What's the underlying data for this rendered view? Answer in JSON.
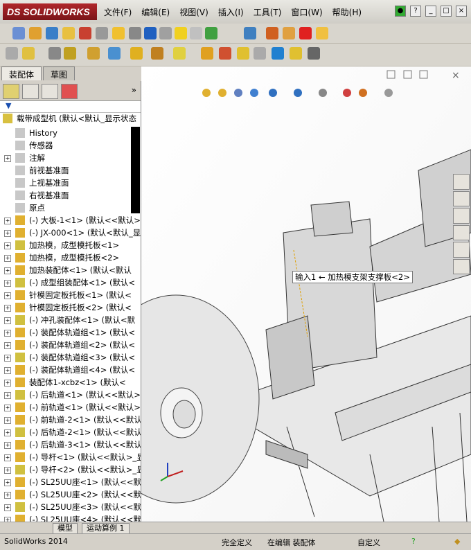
{
  "app": {
    "logo_text": "DS SOLIDWORKS"
  },
  "menu": [
    "文件(F)",
    "编辑(E)",
    "视图(V)",
    "插入(I)",
    "工具(T)",
    "窗口(W)",
    "帮助(H)"
  ],
  "panel_tabs": [
    {
      "label": "装配体",
      "active": true
    },
    {
      "label": "草图",
      "active": false
    }
  ],
  "tree": {
    "root": "载带成型机  (默认<默认_显示状态",
    "items": [
      {
        "label": "History",
        "expand": false
      },
      {
        "label": "传感器",
        "expand": false
      },
      {
        "label": "注解",
        "expand": true
      },
      {
        "label": "前视基准面",
        "expand": false
      },
      {
        "label": "上视基准面",
        "expand": false
      },
      {
        "label": "右视基准面",
        "expand": false
      },
      {
        "label": "原点",
        "expand": false
      },
      {
        "label": "(-) 大板-1<1> (默认<<默认>",
        "expand": true
      },
      {
        "label": "(-) JX-000<1> (默认<默认_显",
        "expand": true
      },
      {
        "label": "加热模，成型模托板<1>",
        "expand": true
      },
      {
        "label": "加热模，成型模托板<2>",
        "expand": true
      },
      {
        "label": "加热装配体<1> (默认<默认",
        "expand": true
      },
      {
        "label": "(-) 成型组装配体<1> (默认<",
        "expand": true
      },
      {
        "label": "针模固定板托板<1> (默认<",
        "expand": true
      },
      {
        "label": "针模固定板托板<2> (默认<",
        "expand": true
      },
      {
        "label": "(-) 冲孔装配体<1> (默认<默",
        "expand": true
      },
      {
        "label": "(-) 装配体轨道组<1> (默认<",
        "expand": true
      },
      {
        "label": "(-) 装配体轨道组<2> (默认<",
        "expand": true
      },
      {
        "label": "(-) 装配体轨道组<3> (默认<",
        "expand": true
      },
      {
        "label": "(-) 装配体轨道组<4> (默认<",
        "expand": true
      },
      {
        "label": "装配体1-xcbz<1> (默认<",
        "expand": true
      },
      {
        "label": "(-) 后轨道<1> (默认<<默认>",
        "expand": true
      },
      {
        "label": "(-) 前轨道<1> (默认<<默认>",
        "expand": true
      },
      {
        "label": "(-) 前轨道-2<1> (默认<<默认",
        "expand": true
      },
      {
        "label": "(-) 后轨道-2<1> (默认<<默认",
        "expand": true
      },
      {
        "label": "(-) 后轨道-3<1> (默认<<默认",
        "expand": true
      },
      {
        "label": "(-) 导杆<1> (默认<<默认>_显",
        "expand": true
      },
      {
        "label": "(-) 导杆<2> (默认<<默认>_显",
        "expand": true
      },
      {
        "label": "(-) SL25UU座<1> (默认<<默认",
        "expand": true
      },
      {
        "label": "(-) SL25UU座<2> (默认<<默认",
        "expand": true
      },
      {
        "label": "(-) SL25UU座<3> (默认<<默认",
        "expand": true
      },
      {
        "label": "(-) SL25UU座<4> (默认<<默认",
        "expand": true
      }
    ]
  },
  "viewport": {
    "callout": "输入1 ← 加热模支架支撑板<2>"
  },
  "bottom_tabs": [
    "模型",
    "运动算例 1"
  ],
  "status": {
    "app_version": "SolidWorks 2014",
    "state": "完全定义",
    "mode": "在编辑 装配体",
    "units": "自定义"
  }
}
